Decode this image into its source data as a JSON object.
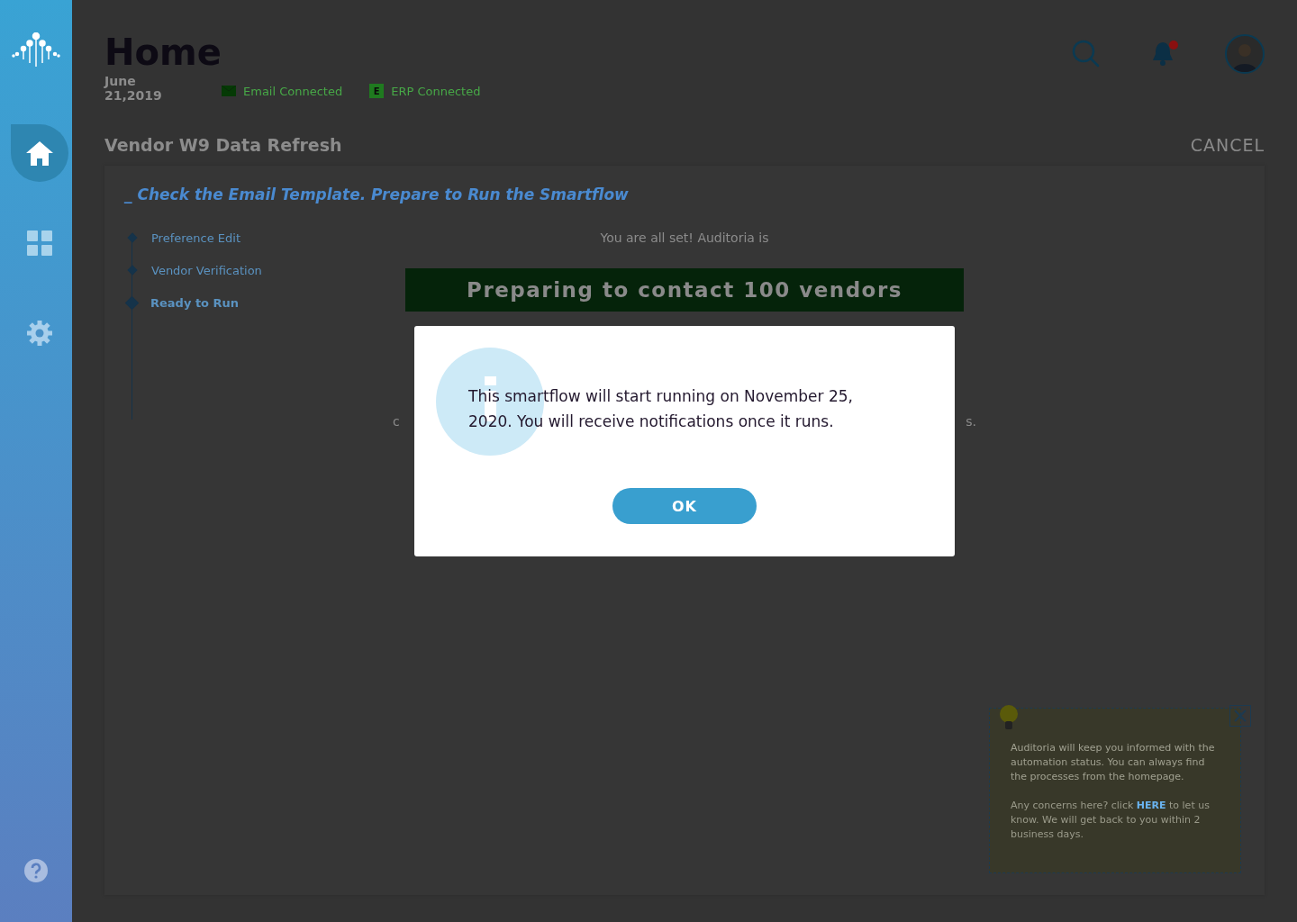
{
  "sidebar": {
    "items": [
      {
        "kind": "home",
        "selected": true
      },
      {
        "kind": "grid",
        "selected": false
      },
      {
        "kind": "settings",
        "selected": false
      }
    ]
  },
  "header": {
    "title": "Home",
    "date": "June 21,2019",
    "connections": [
      {
        "kind": "email",
        "label": "Email Connected"
      },
      {
        "kind": "erp",
        "badge": "E",
        "label": "ERP Connected"
      }
    ],
    "notification_unread": true
  },
  "flow": {
    "title": "Vendor W9 Data Refresh",
    "cancel": "CANCEL",
    "heading_mark": "_",
    "heading": "Check the Email Template. Prepare to Run the Smartflow",
    "steps": [
      {
        "label": "Preference Edit",
        "selected": false
      },
      {
        "label": "Vendor Verification",
        "selected": false
      },
      {
        "label": "Ready to Run",
        "selected": true
      }
    ],
    "status_text": "You are all set! Auditoria is",
    "banner": "Preparing to contact 100 vendors",
    "fragment_left": "c",
    "fragment_right": "s."
  },
  "tip": {
    "text": "Auditoria will keep you informed with the automation status. You can always find the processes from the homepage.",
    "concern_before": "Any concerns here? click",
    "link": "HERE",
    "concern_after": "to let us know. We will get back to you within 2 business days."
  },
  "dialog": {
    "message": "This smartflow will start running on November 25, 2020. You will receive notifications once it runs.",
    "button": "OK"
  }
}
